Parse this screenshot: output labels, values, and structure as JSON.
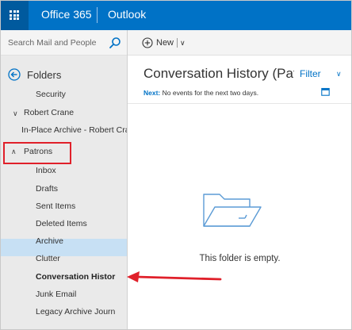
{
  "header": {
    "brand": "Office 365",
    "app": "Outlook"
  },
  "search": {
    "placeholder": "Search Mail and People"
  },
  "folders": {
    "title": "Folders",
    "items": [
      {
        "label": "Security"
      },
      {
        "label": "Robert Crane"
      },
      {
        "label": "In-Place Archive - Robert Crane"
      },
      {
        "label": "Patrons"
      },
      {
        "label": "Inbox"
      },
      {
        "label": "Drafts"
      },
      {
        "label": "Sent Items"
      },
      {
        "label": "Deleted Items"
      },
      {
        "label": "Archive"
      },
      {
        "label": "Clutter"
      },
      {
        "label": "Conversation Histor"
      },
      {
        "label": "Junk Email"
      },
      {
        "label": "Legacy Archive Journ"
      }
    ],
    "selected_index": 10
  },
  "toolbar": {
    "new_label": "New"
  },
  "main": {
    "title": "Conversation History (Patro",
    "filter_label": "Filter",
    "next_label": "Next:",
    "next_text": "No events for the next two days.",
    "empty_message": "This folder is empty."
  },
  "colors": {
    "brand_blue": "#0072c6",
    "selected_bg": "#c7e0f4",
    "annotation_red": "#e0202a"
  },
  "icons": {
    "waffle": "app-launcher-icon",
    "search": "search-icon",
    "back": "back-arrow-icon",
    "new": "plus-circle-icon",
    "calendar": "calendar-icon",
    "empty": "open-folder-icon"
  }
}
